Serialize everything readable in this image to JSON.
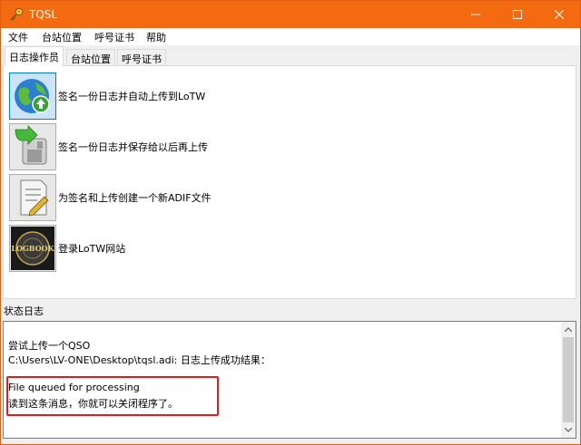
{
  "window": {
    "title": "TQSL"
  },
  "menu": [
    "文件",
    "台站位置",
    "呼号证书",
    "帮助"
  ],
  "tabs": [
    {
      "label": "日志操作员",
      "active": true
    },
    {
      "label": "台站位置",
      "active": false
    },
    {
      "label": "呼号证书",
      "active": false
    }
  ],
  "actions": [
    {
      "label": "签名一份日志并自动上传到LoTW",
      "icon": "globe-upload-icon",
      "selected": true
    },
    {
      "label": "签名一份日志并保存给以后再上传",
      "icon": "save-arrow-icon",
      "selected": false
    },
    {
      "label": "为签名和上传创建一个新ADIF文件",
      "icon": "edit-document-icon",
      "selected": false
    },
    {
      "label": "登录LoTW网站",
      "icon": "logbook-icon",
      "selected": false
    }
  ],
  "logbook_logo_text": "LOGBOOK",
  "status": {
    "label": "状态日志",
    "lines": [
      "尝试上传一个QSO",
      "C:\\Users\\LV-ONE\\Desktop\\tqsl.adi: 日志上传成功结果：",
      "",
      "File queued for processing",
      "读到这条消息，你就可以关闭程序了。"
    ]
  },
  "colors": {
    "titlebar": "#f36a11",
    "highlight": "#e81a1a",
    "selected": "#0078d7"
  }
}
